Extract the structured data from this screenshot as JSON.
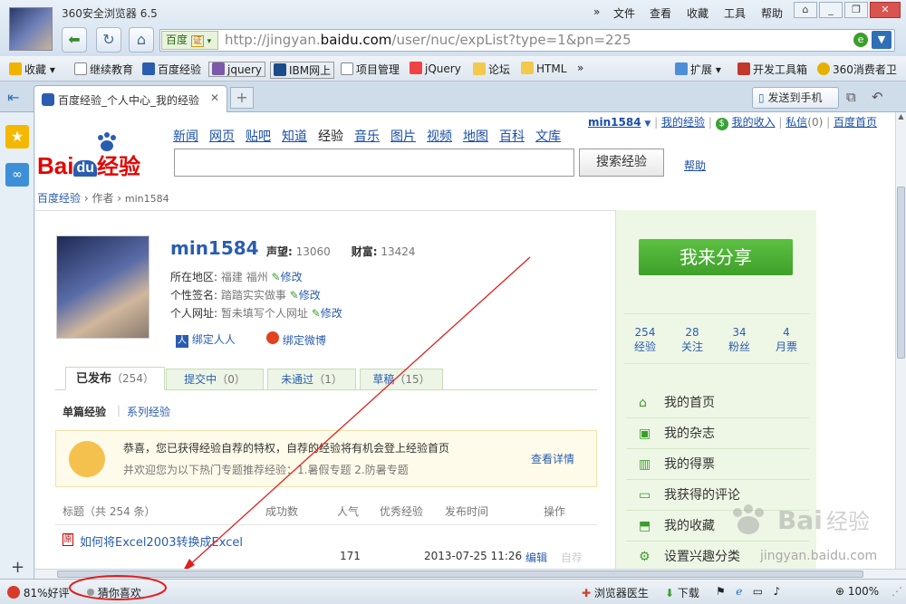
{
  "window": {
    "title": "360安全浏览器 6.5",
    "menus": [
      "文件",
      "查看",
      "收藏",
      "工具",
      "帮助"
    ]
  },
  "address": {
    "engine": "百度",
    "engine_badge": "证",
    "url_prefix": "http://jingyan.",
    "url_domain": "baidu.com",
    "url_suffix": "/user/nuc/expList?type=1&pn=225"
  },
  "bookmarks": {
    "fav": "收藏",
    "items": [
      "继续教育",
      "百度经验",
      "jquery",
      "IBM网上",
      "项目管理",
      "jQuery",
      "论坛",
      "HTML"
    ],
    "right": [
      "扩展",
      "开发工具箱",
      "360消费者卫"
    ]
  },
  "tab": {
    "title": "百度经验_个人中心_我的经验",
    "send": "发送到手机"
  },
  "page": {
    "top_nav": [
      "新闻",
      "网页",
      "贴吧",
      "知道",
      "经验",
      "音乐",
      "图片",
      "视频",
      "地图",
      "百科",
      "文库"
    ],
    "user_links": {
      "username": "min1584",
      "my_exp": "我的经验",
      "my_income": "我的收入",
      "msg": "私信",
      "msg_count": "(0)",
      "home": "百度首页"
    },
    "logo_text": "Bai",
    "logo_du": "du",
    "logo_exp": "经验",
    "search_btn": "搜索经验",
    "help": "帮助",
    "breadcrumb": {
      "a": "百度经验",
      "b": "作者",
      "c": "min1584"
    },
    "profile": {
      "name": "min1584",
      "fame_label": "声望:",
      "fame": "13060",
      "wealth_label": "财富:",
      "wealth": "13424",
      "region_label": "所在地区:",
      "region": "福建 福州",
      "sig_label": "个性签名:",
      "sig": "踏踏实实做事",
      "site_label": "个人网址:",
      "site": "暂未填写个人网址",
      "edit": "修改",
      "bind_renren": "绑定人人",
      "bind_weibo": "绑定微博"
    },
    "tabs": [
      {
        "label": "已发布",
        "count": "（254）"
      },
      {
        "label": "提交中",
        "count": "（0）"
      },
      {
        "label": "未通过",
        "count": "（1）"
      },
      {
        "label": "草稿",
        "count": "（15）"
      }
    ],
    "subtabs": [
      "单篇经验",
      "系列经验"
    ],
    "notice": {
      "line1": "恭喜，您已获得经验自荐的特权，自荐的经验将有机会登上经验首页",
      "line2": "并欢迎您为以下热门专题推荐经验：1.暑假专题 2.防暑专题",
      "link": "查看详情"
    },
    "table": {
      "headers": [
        "标题（共 254 条）",
        "成功数",
        "人气",
        "优秀经验",
        "发布时间",
        "操作"
      ],
      "row": {
        "title": "如何将Excel2003转换成Excel",
        "views": "171",
        "time": "2013-07-25 11:26",
        "edit": "编辑",
        "rec": "自荐"
      }
    },
    "share_btn": "我来分享",
    "stats": [
      {
        "n": "254",
        "l": "经验"
      },
      {
        "n": "28",
        "l": "关注"
      },
      {
        "n": "34",
        "l": "粉丝"
      },
      {
        "n": "4",
        "l": "月票"
      }
    ],
    "menu": [
      "我的首页",
      "我的杂志",
      "我的得票",
      "我获得的评论",
      "我的收藏",
      "设置兴趣分类"
    ],
    "watermark": "jingyan.baidu.com"
  },
  "status": {
    "rating": "81%好评",
    "guess": "猜你喜欢",
    "doctor": "浏览器医生",
    "download": "下载",
    "zoom": "100%"
  }
}
